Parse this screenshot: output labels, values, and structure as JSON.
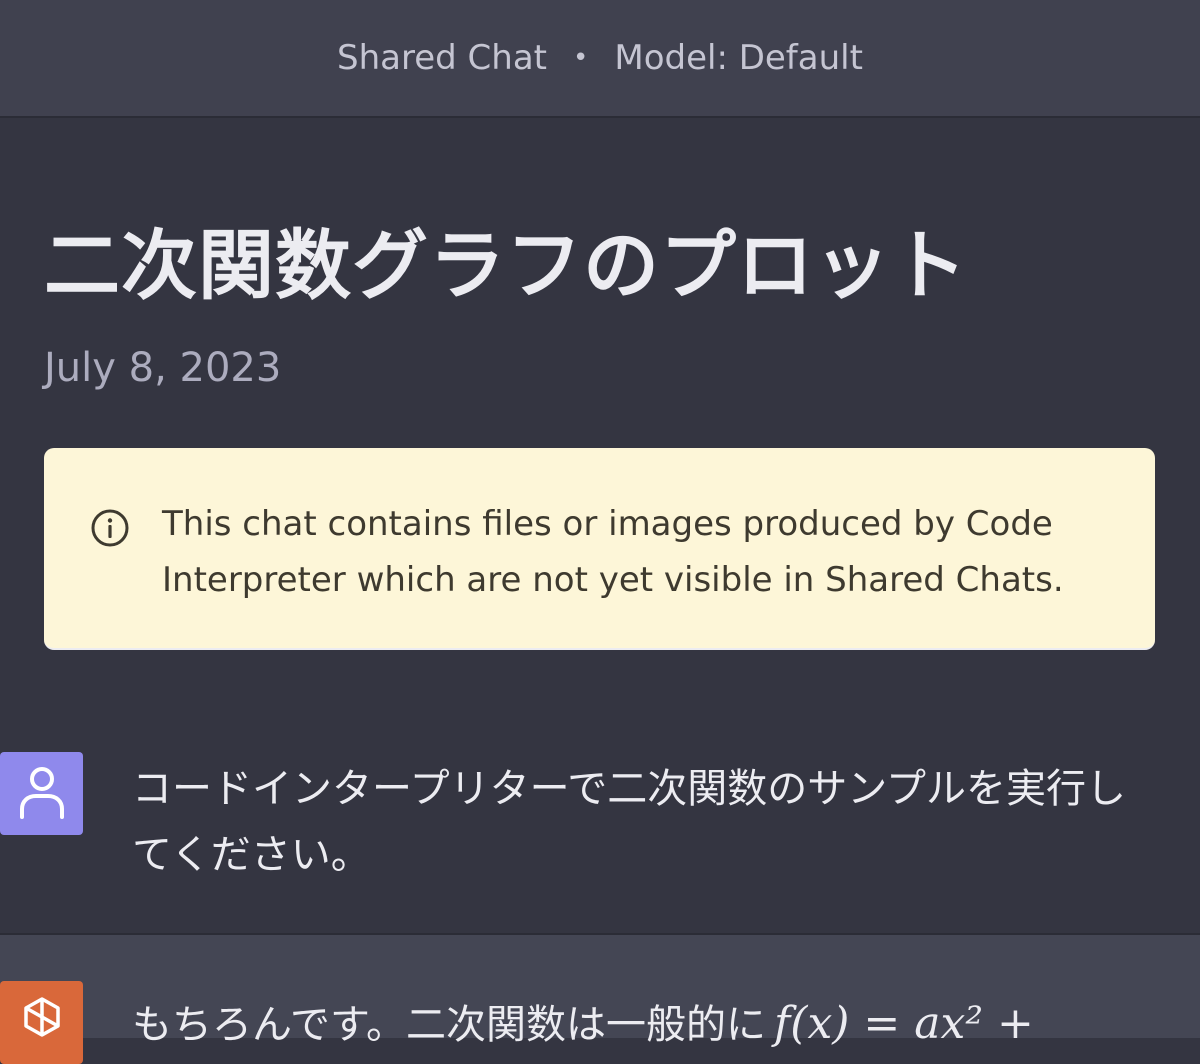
{
  "header": {
    "label": "Shared Chat",
    "separator": "•",
    "model": "Model: Default"
  },
  "conversation": {
    "title": "二次関数グラフのプロット",
    "date": "July 8, 2023"
  },
  "notice": {
    "icon": "info-icon",
    "text": "This chat contains files or images produced by Code Interpreter which are not yet visible in Shared Chats."
  },
  "messages": [
    {
      "role": "user",
      "avatar_icon": "user-icon",
      "avatar_color": "#8f89ec",
      "text": "コードインタープリターで二次関数のサンプルを実行してください。"
    },
    {
      "role": "assistant",
      "avatar_icon": "openai-logo-icon",
      "avatar_color": "#d9683a",
      "text": "もちろんです。二次関数は一般的に",
      "formula": "f(x) = ax² +"
    }
  ],
  "colors": {
    "background": "#343541",
    "header_background": "#40414f",
    "notice_background": "#fdf6d8",
    "assistant_background": "#444654"
  }
}
